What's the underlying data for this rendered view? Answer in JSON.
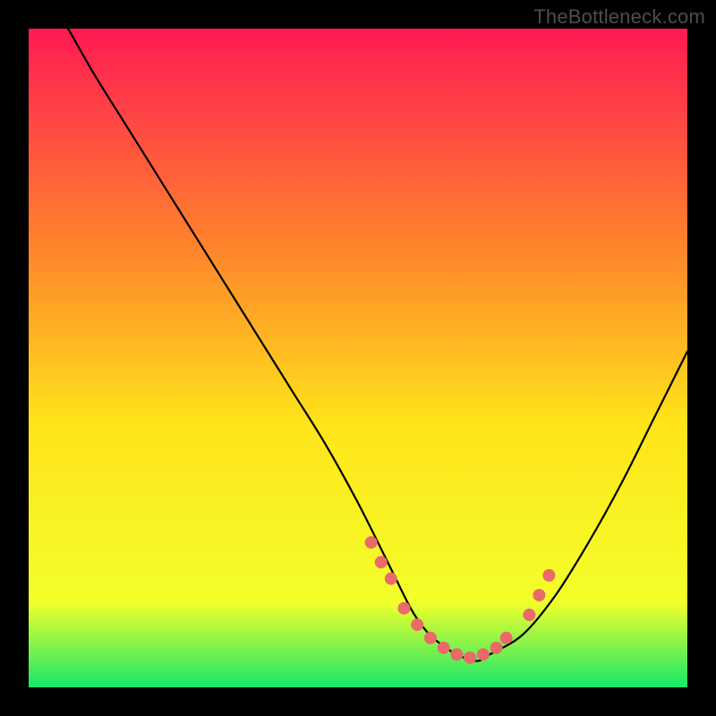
{
  "watermark": "TheBottleneck.com",
  "colors": {
    "background": "#000000",
    "curve": "#000000",
    "dots": "#ea6a6a",
    "gradient_top": "#ff1a54",
    "gradient_upper_mid": "#ff8a2a",
    "gradient_mid": "#ffe41a",
    "gradient_lower_mid": "#f3ff2a",
    "gradient_bottom": "#17e86a",
    "watermark": "#4d4d4d"
  },
  "chart_data": {
    "type": "line",
    "title": "",
    "xlabel": "",
    "ylabel": "",
    "xlim": [
      0,
      100
    ],
    "ylim": [
      0,
      100
    ],
    "curve": {
      "x": [
        6,
        10,
        15,
        20,
        25,
        30,
        35,
        40,
        45,
        50,
        55,
        58,
        60,
        62,
        65,
        68,
        70,
        75,
        80,
        85,
        90,
        95,
        100
      ],
      "y": [
        100,
        93,
        85,
        77,
        69,
        61,
        53,
        45,
        37,
        28,
        18,
        12,
        9,
        7,
        5,
        4,
        5,
        8,
        14,
        22,
        31,
        41,
        51
      ]
    },
    "dots": {
      "x": [
        52,
        53.5,
        55,
        57,
        59,
        61,
        63,
        65,
        67,
        69,
        71,
        72.5,
        76,
        77.5,
        79
      ],
      "y": [
        22,
        19,
        16.5,
        12,
        9.5,
        7.5,
        6,
        5,
        4.5,
        5,
        6,
        7.5,
        11,
        14,
        17
      ]
    }
  }
}
